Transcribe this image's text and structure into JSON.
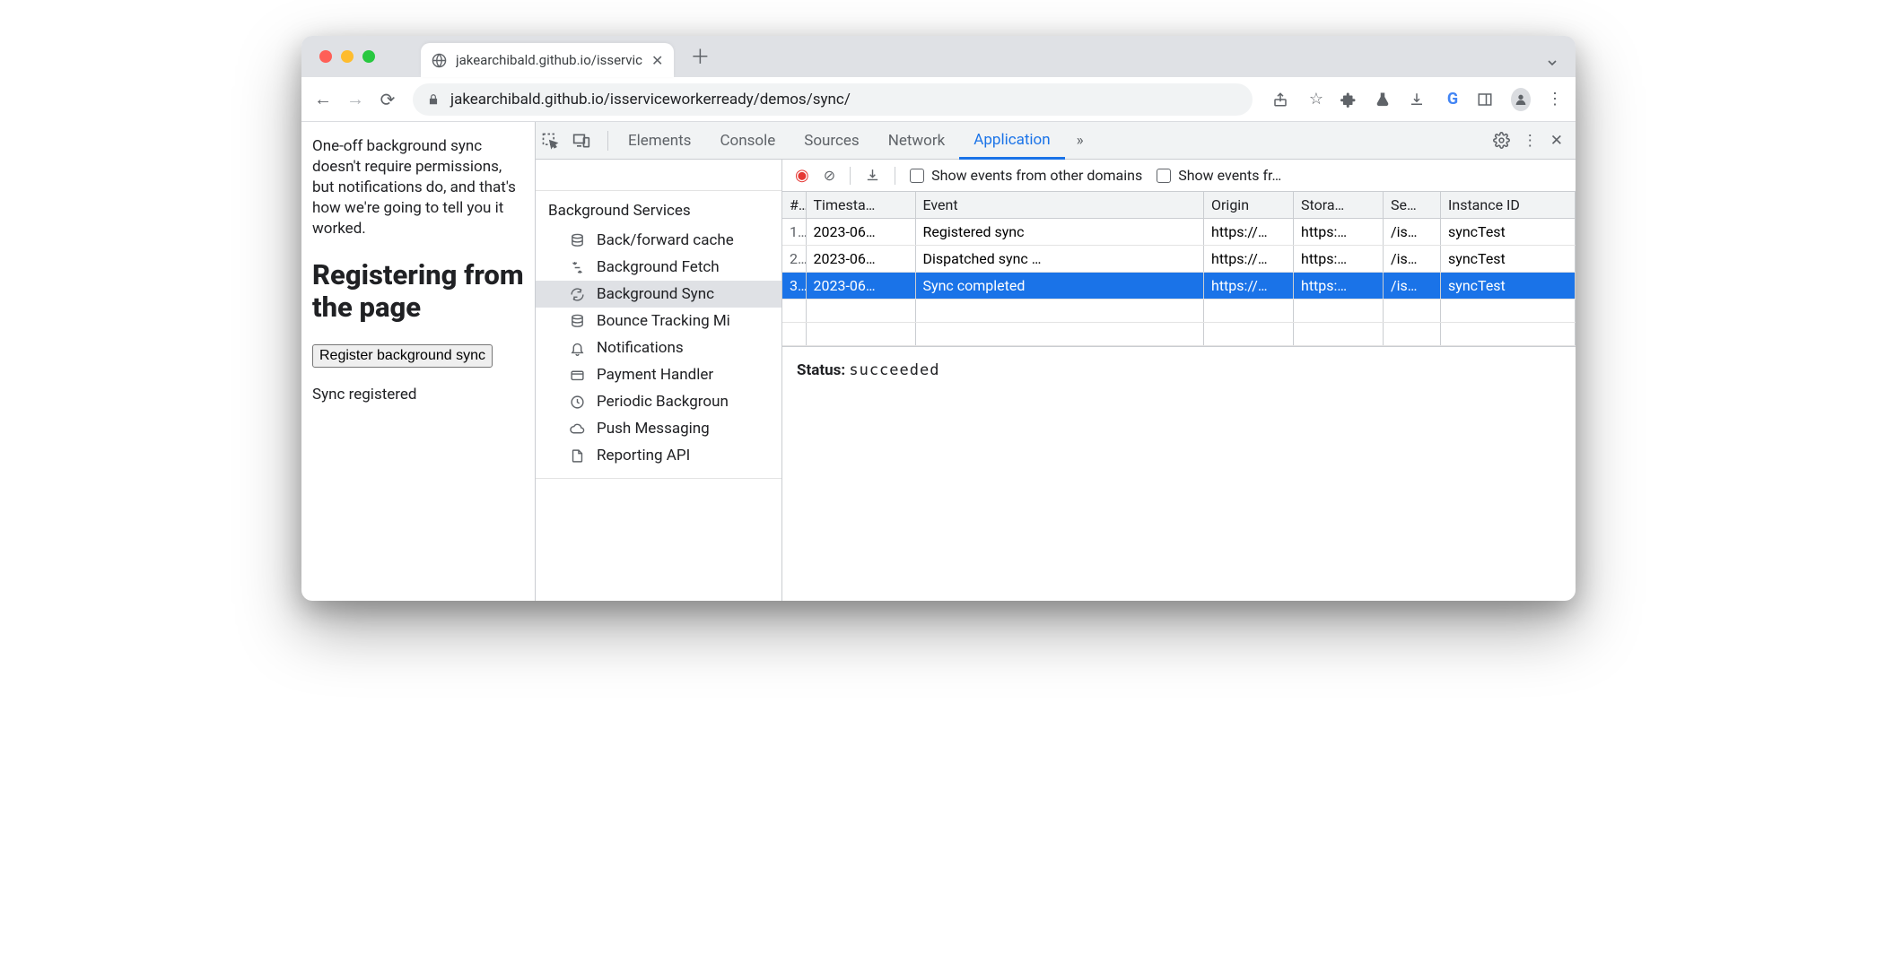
{
  "browser": {
    "tab_title": "jakearchibald.github.io/isservic",
    "url": "jakearchibald.github.io/isserviceworkerready/demos/sync/"
  },
  "page": {
    "intro": "One-off background sync doesn't require permissions, but notifications do, and that's how we're going to tell you it worked.",
    "heading": "Registering from the page",
    "button": "Register background sync",
    "status": "Sync registered"
  },
  "devtools": {
    "tabs": [
      "Elements",
      "Console",
      "Sources",
      "Network",
      "Application"
    ],
    "active_tab": "Application"
  },
  "sidebar": {
    "section": "Background Services",
    "items": [
      "Back/forward cache",
      "Background Fetch",
      "Background Sync",
      "Bounce Tracking Mi",
      "Notifications",
      "Payment Handler",
      "Periodic Backgroun",
      "Push Messaging",
      "Reporting API"
    ],
    "selected_index": 2
  },
  "toolbar": {
    "show_other": "Show events from other domains",
    "show_fr": "Show events fr…"
  },
  "table": {
    "headers": [
      "#",
      "Timesta…",
      "Event",
      "Origin",
      "Stora…",
      "Se…",
      "Instance ID"
    ],
    "rows": [
      {
        "n": "1.",
        "ts": "2023-06…",
        "event": "Registered sync",
        "origin": "https://…",
        "storage": "https:…",
        "scope": "/is…",
        "id": "syncTest"
      },
      {
        "n": "2.",
        "ts": "2023-06…",
        "event": "Dispatched sync …",
        "origin": "https://…",
        "storage": "https:…",
        "scope": "/is…",
        "id": "syncTest"
      },
      {
        "n": "3.",
        "ts": "2023-06…",
        "event": "Sync completed",
        "origin": "https://…",
        "storage": "https:…",
        "scope": "/is…",
        "id": "syncTest"
      }
    ],
    "selected_index": 2
  },
  "detail": {
    "status_label": "Status:",
    "status_value": "succeeded"
  }
}
